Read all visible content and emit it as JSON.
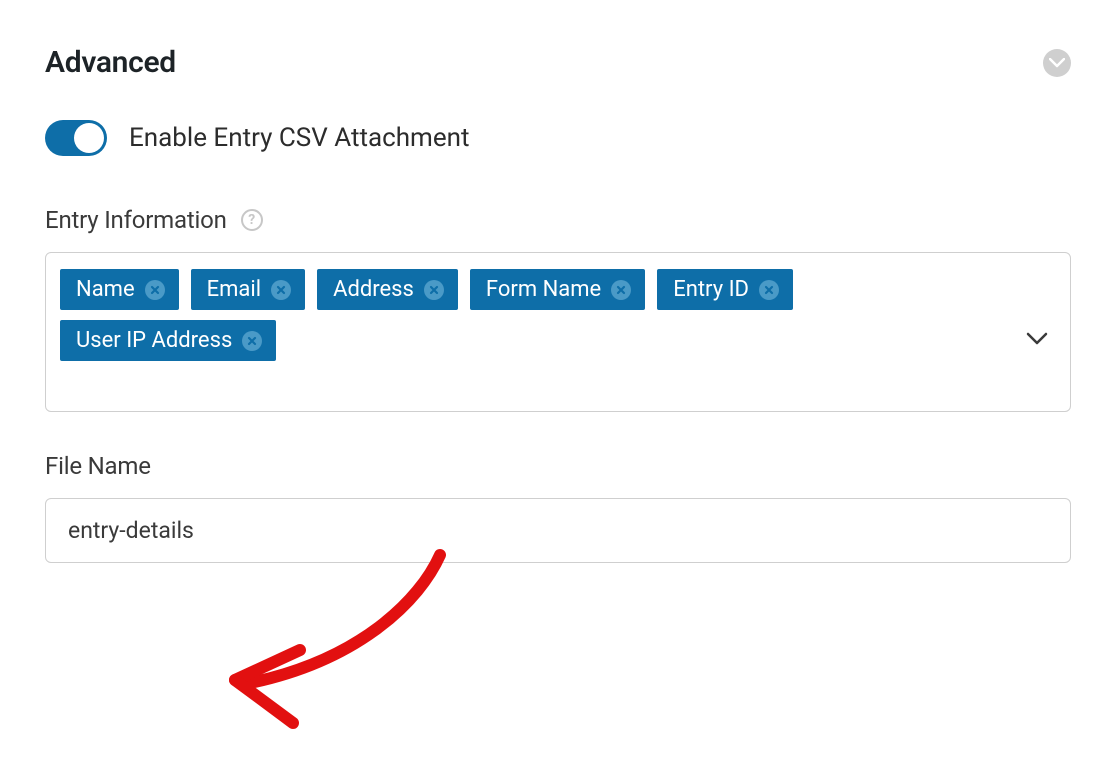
{
  "section": {
    "title": "Advanced"
  },
  "toggle": {
    "label": "Enable Entry CSV Attachment",
    "enabled": true
  },
  "entryInfo": {
    "label": "Entry Information",
    "tags": [
      "Name",
      "Email",
      "Address",
      "Form Name",
      "Entry ID",
      "User IP Address"
    ]
  },
  "fileName": {
    "label": "File Name",
    "value": "entry-details"
  }
}
